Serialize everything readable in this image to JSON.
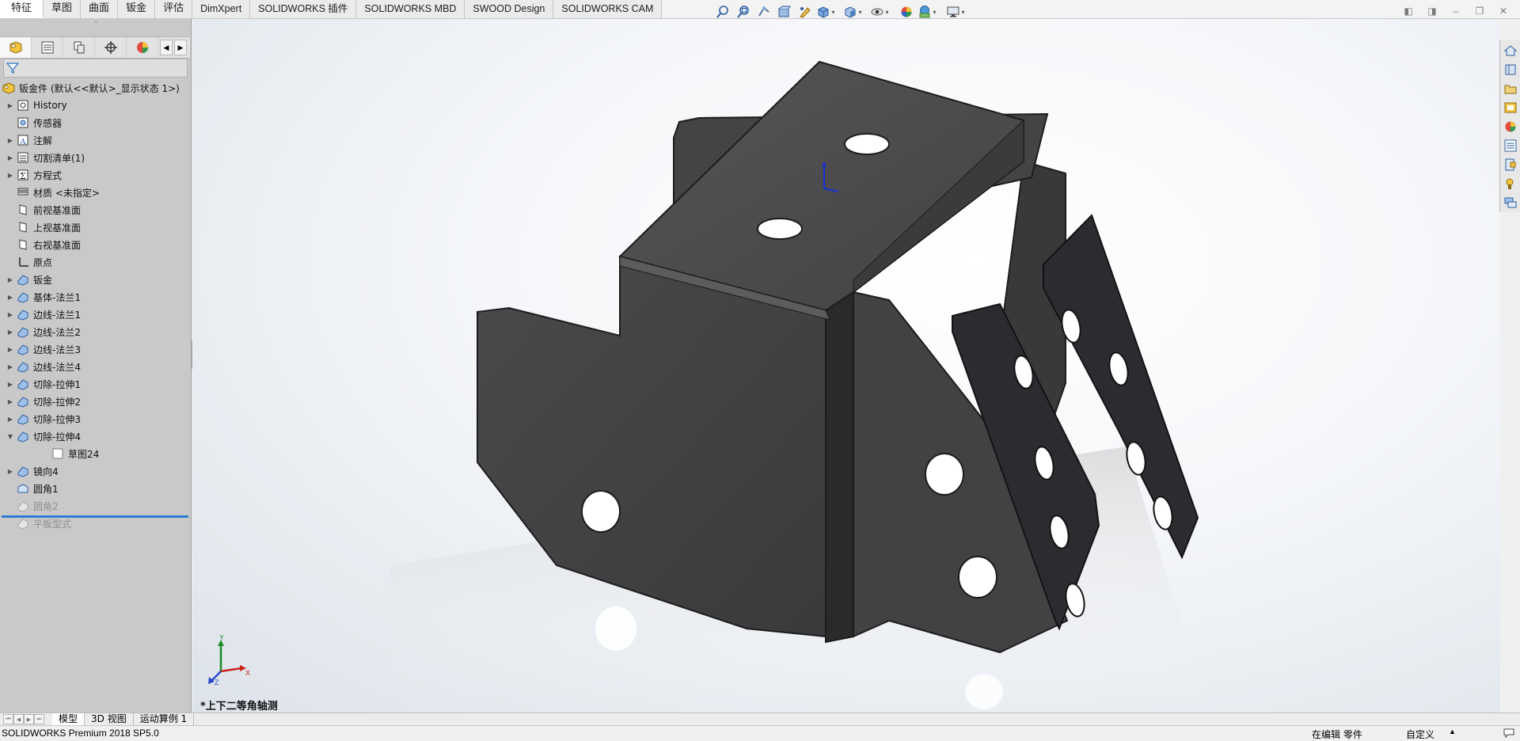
{
  "command_tabs": [
    {
      "label": "特征",
      "active": true
    },
    {
      "label": "草图"
    },
    {
      "label": "曲面"
    },
    {
      "label": "钣金"
    },
    {
      "label": "评估"
    },
    {
      "label": "DimXpert"
    },
    {
      "label": "SOLIDWORKS 插件"
    },
    {
      "label": "SOLIDWORKS MBD"
    },
    {
      "label": "SWOOD Design"
    },
    {
      "label": "SOLIDWORKS CAM"
    }
  ],
  "hud_icons": [
    "zoom-to-fit-icon",
    "zoom-to-area-icon",
    "previous-view-icon",
    "section-view-icon",
    "dynamic-annotation-icon",
    "view-orientation-icon",
    "display-style-icon",
    "hide-show-items-icon",
    "edit-appearance-icon",
    "apply-scene-icon",
    "view-settings-icon"
  ],
  "feature_tree": {
    "root": "钣金件 (默认<<默认>_显示状态 1>)",
    "items": [
      {
        "label": "History",
        "expandable": true
      },
      {
        "label": "传感器",
        "expandable": false
      },
      {
        "label": "注解",
        "expandable": true
      },
      {
        "label": "切割清单(1)",
        "expandable": true
      },
      {
        "label": "方程式",
        "expandable": true
      },
      {
        "label": "材质 <未指定>",
        "expandable": false
      },
      {
        "label": "前视基准面",
        "expandable": false
      },
      {
        "label": "上视基准面",
        "expandable": false
      },
      {
        "label": "右视基准面",
        "expandable": false
      },
      {
        "label": "原点",
        "expandable": false
      },
      {
        "label": "钣金",
        "expandable": true
      },
      {
        "label": "基体-法兰1",
        "expandable": true
      },
      {
        "label": "边线-法兰1",
        "expandable": true
      },
      {
        "label": "边线-法兰2",
        "expandable": true
      },
      {
        "label": "边线-法兰3",
        "expandable": true
      },
      {
        "label": "边线-法兰4",
        "expandable": true
      },
      {
        "label": "切除-拉伸1",
        "expandable": true
      },
      {
        "label": "切除-拉伸2",
        "expandable": true
      },
      {
        "label": "切除-拉伸3",
        "expandable": true
      },
      {
        "label": "切除-拉伸4",
        "expandable": true,
        "expanded": true
      },
      {
        "label": "草图24",
        "child": true
      },
      {
        "label": "镜向4",
        "expandable": true
      },
      {
        "label": "圆角1",
        "expandable": false
      },
      {
        "label": "圆角2",
        "disabled": true
      },
      {
        "label": "平板型式",
        "disabled": true
      }
    ]
  },
  "viewport": {
    "view_name": "*上下二等角轴测",
    "triad": {
      "x": "X",
      "y": "Y",
      "z": "Z"
    }
  },
  "bottom_tabs": [
    "模型",
    "3D 视图",
    "运动算例 1"
  ],
  "status": {
    "product": "SOLIDWORKS Premium 2018 SP5.0",
    "editing": "在编辑 零件",
    "units": "自定义"
  },
  "colors": {
    "panel_bg": "#c9c9c9",
    "part_dark": "#3d3d3f",
    "rollback_bar": "#2d7bd6"
  }
}
